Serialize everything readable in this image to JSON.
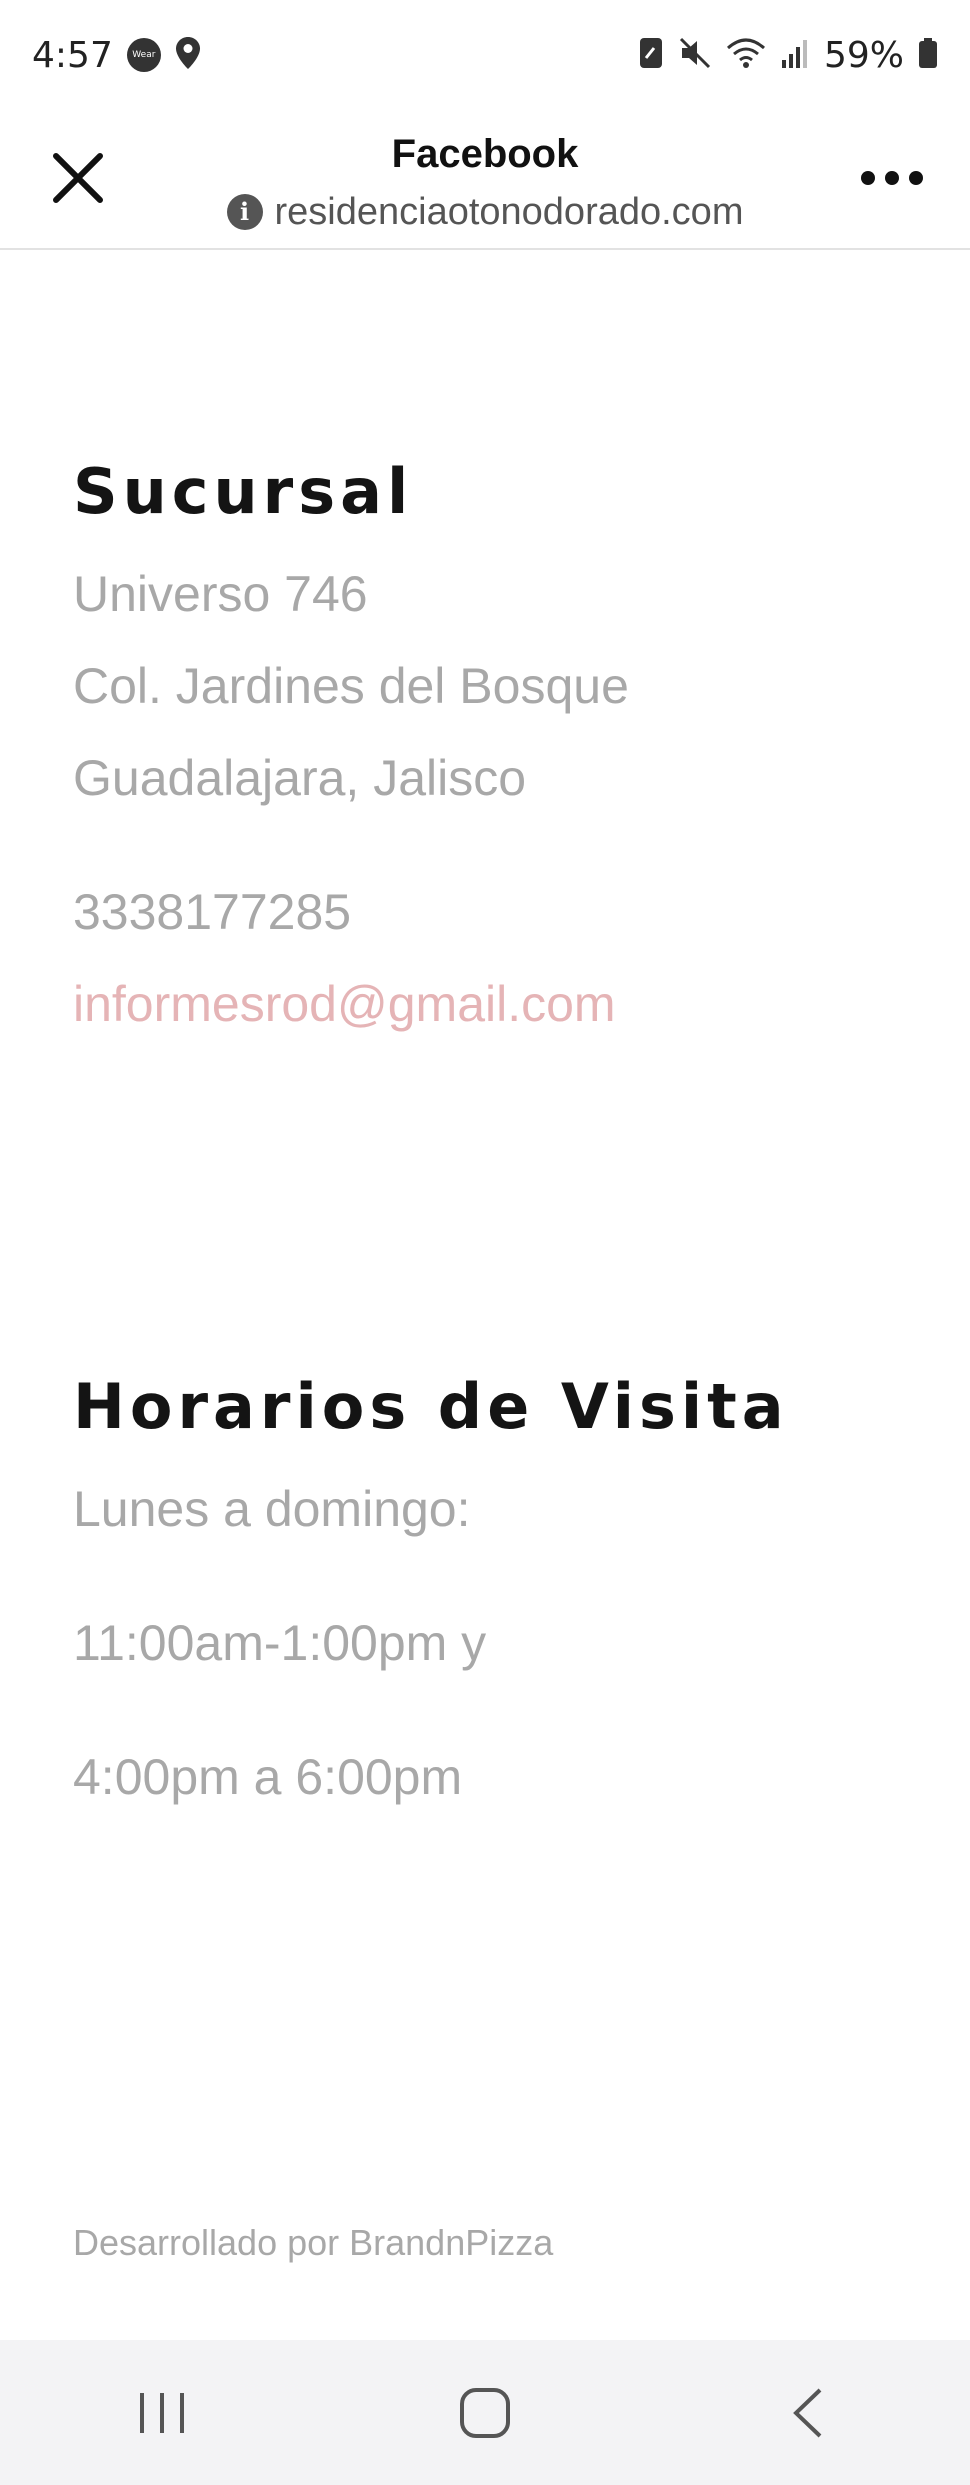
{
  "status_bar": {
    "time": "4:57",
    "wear_badge": "Wear",
    "battery": "59%"
  },
  "header": {
    "title": "Facebook",
    "url": "residenciaotonodorado.com"
  },
  "sucursal": {
    "heading": "Sucursal",
    "address_line1": "Universo 746",
    "address_line2": "Col. Jardines del Bosque",
    "address_line3": "Guadalajara, Jalisco",
    "phone": "3338177285",
    "email": "informesrod@gmail.com"
  },
  "horarios": {
    "heading": "Horarios de Visita",
    "line1": "Lunes a domingo:",
    "line2": "11:00am-1:00pm y",
    "line3": "4:00pm a 6:00pm"
  },
  "footer": {
    "credit": "Desarrollado por BrandnPizza"
  },
  "colors": {
    "heading": "#141414",
    "body_text": "#a8a8a8",
    "link": "#e5b4b6",
    "nav_bg": "#f3f3f5"
  }
}
